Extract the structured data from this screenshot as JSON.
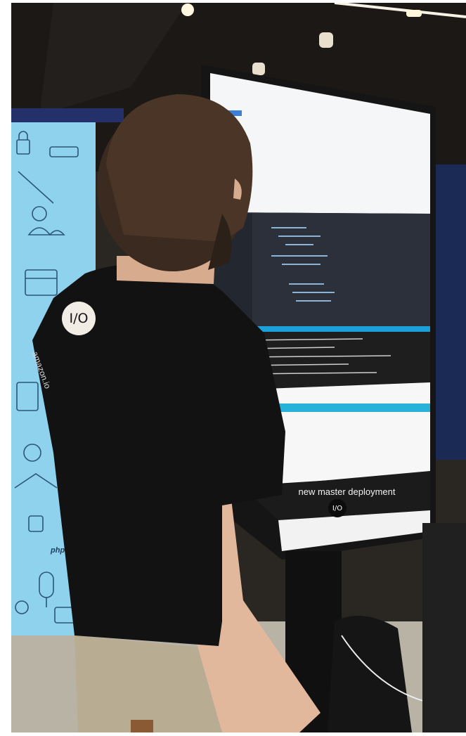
{
  "photo": {
    "screen_banner": "new master deployment",
    "screen_logo": "I/O",
    "shirt_logo": "I/O",
    "shirt_text": "amazon.io",
    "backdrop_text": "php"
  },
  "colors": {
    "backdrop_blue": "#8fd2ee",
    "editor_dark": "#2b303b",
    "terminal_dark": "#1e1e1e",
    "status_bar_blue": "#1ca0d9",
    "shirt_black": "#121212"
  }
}
